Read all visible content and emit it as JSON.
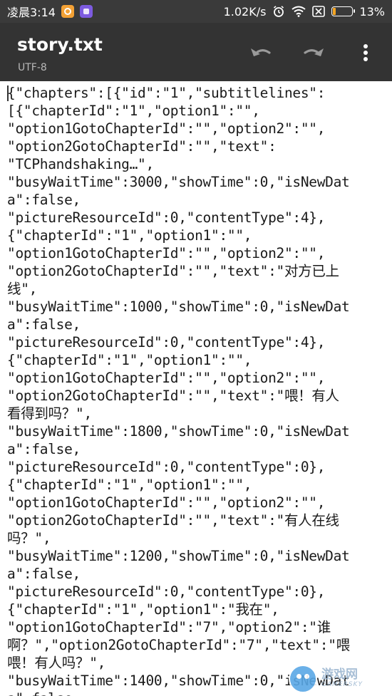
{
  "status_bar": {
    "time": "凌晨3:14",
    "network_speed": "1.02K/s",
    "battery_percent": "13%",
    "battery_level": 0.13,
    "icons": [
      "notification-app-icon-orange",
      "notification-app-icon-purple",
      "alarm-icon",
      "wifi-icon",
      "sim-disabled-icon",
      "battery-icon"
    ]
  },
  "app_bar": {
    "file_name": "story.txt",
    "encoding": "UTF-8",
    "actions": [
      "undo-icon",
      "redo-icon",
      "more-vert-icon"
    ]
  },
  "editor": {
    "content": "{\"chapters\":[{\"id\":\"1\",\"subtitlelines\":\n[{\"chapterId\":\"1\",\"option1\":\"\",\n\"option1GotoChapterId\":\"\",\"option2\":\"\",\n\"option2GotoChapterId\":\"\",\"text\":\n\"TCPhandshaking…\",\n\"busyWaitTime\":3000,\"showTime\":0,\"isNewDat\na\":false,\n\"pictureResourceId\":0,\"contentType\":4},\n{\"chapterId\":\"1\",\"option1\":\"\",\n\"option1GotoChapterId\":\"\",\"option2\":\"\",\n\"option2GotoChapterId\":\"\",\"text\":\"对方已上\n线\",\n\"busyWaitTime\":1000,\"showTime\":0,\"isNewDat\na\":false,\n\"pictureResourceId\":0,\"contentType\":4},\n{\"chapterId\":\"1\",\"option1\":\"\",\n\"option1GotoChapterId\":\"\",\"option2\":\"\",\n\"option2GotoChapterId\":\"\",\"text\":\"喂！有人\n看得到吗？\",\n\"busyWaitTime\":1800,\"showTime\":0,\"isNewDat\na\":false,\n\"pictureResourceId\":0,\"contentType\":0},\n{\"chapterId\":\"1\",\"option1\":\"\",\n\"option1GotoChapterId\":\"\",\"option2\":\"\",\n\"option2GotoChapterId\":\"\",\"text\":\"有人在线\n吗？\",\n\"busyWaitTime\":1200,\"showTime\":0,\"isNewDat\na\":false,\n\"pictureResourceId\":0,\"contentType\":0},\n{\"chapterId\":\"1\",\"option1\":\"我在\",\n\"option1GotoChapterId\":\"7\",\"option2\":\"谁\n啊？\",\"option2GotoChapterId\":\"7\",\"text\":\"喂\n喂！有人吗？\",\n\"busyWaitTime\":1400,\"showTime\":0,\"isNewDat\na\":false"
  },
  "watermark": {
    "cn": "游戏网",
    "en": "GAMERSKY"
  },
  "colors": {
    "status_bar_bg": "#3a3a3a",
    "app_bar_bg": "#333333",
    "editor_bg": "#ffffff",
    "battery_fill": "#f5a623"
  }
}
